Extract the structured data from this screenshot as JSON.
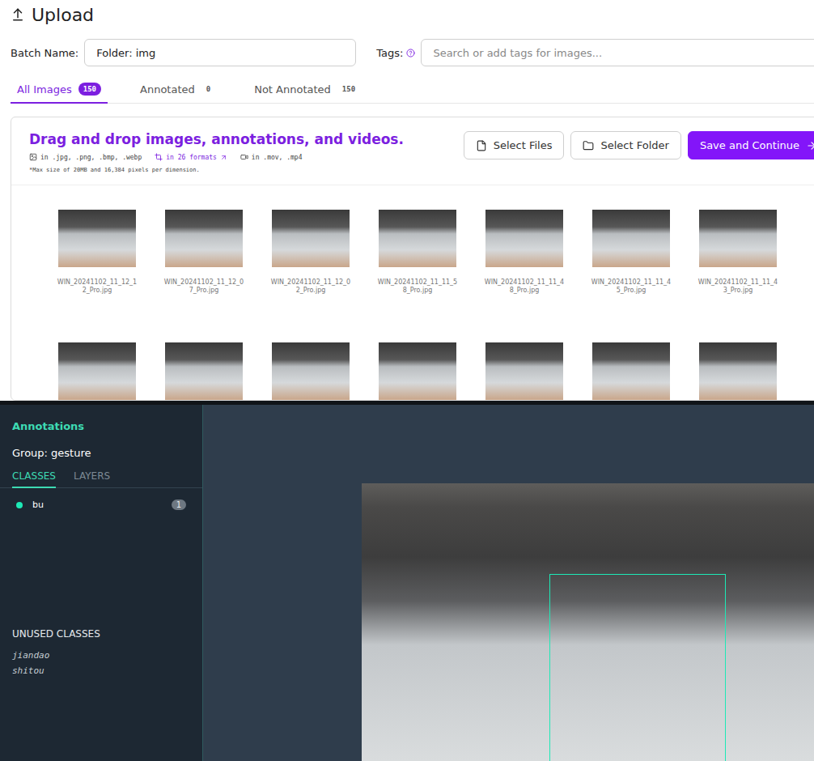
{
  "upload": {
    "title": "Upload",
    "batch_label": "Batch Name:",
    "batch_value": "Folder: img",
    "tags_label": "Tags:",
    "tags_placeholder": "Search or add tags for images..."
  },
  "tabs": [
    {
      "label": "All Images",
      "count": "150",
      "selected": true
    },
    {
      "label": "Annotated",
      "count": "0",
      "selected": false
    },
    {
      "label": "Not Annotated",
      "count": "150",
      "selected": false
    }
  ],
  "dropzone": {
    "title": "Drag and drop images, annotations, and videos.",
    "formats": [
      {
        "kind": "image",
        "text": "in .jpg, .png, .bmp, .webp"
      },
      {
        "kind": "annotation",
        "text": "in 26 formats"
      },
      {
        "kind": "video",
        "text": "in .mov, .mp4"
      }
    ],
    "note": "*Max size of 20MB and 16,384 pixels per dimension."
  },
  "buttons": [
    {
      "label": "Select Files",
      "kind": "file"
    },
    {
      "label": "Select Folder",
      "kind": "folder"
    },
    {
      "label": "Save and Continue",
      "kind": "primary"
    }
  ],
  "thumbnails": [
    "WIN_20241102_11_12_12_Pro.jpg",
    "WIN_20241102_11_12_07_Pro.jpg",
    "WIN_20241102_11_12_02_Pro.jpg",
    "WIN_20241102_11_11_58_Pro.jpg",
    "WIN_20241102_11_11_48_Pro.jpg",
    "WIN_20241102_11_11_45_Pro.jpg",
    "WIN_20241102_11_11_43_Pro.jpg"
  ],
  "partial_thumbnail_count": 7,
  "annotations": {
    "title": "Annotations",
    "group": "Group: gesture",
    "tabs": [
      {
        "label": "CLASSES",
        "selected": true
      },
      {
        "label": "LAYERS",
        "selected": false
      }
    ],
    "classes": [
      {
        "name": "bu",
        "count": "1",
        "color": "#1de9b6"
      }
    ],
    "unused_title": "UNUSED CLASSES",
    "unused": [
      "jiandao",
      "shitou"
    ]
  },
  "canvas": {
    "boxes": [
      {
        "class": "bu",
        "color": "#1de9b6"
      }
    ]
  }
}
